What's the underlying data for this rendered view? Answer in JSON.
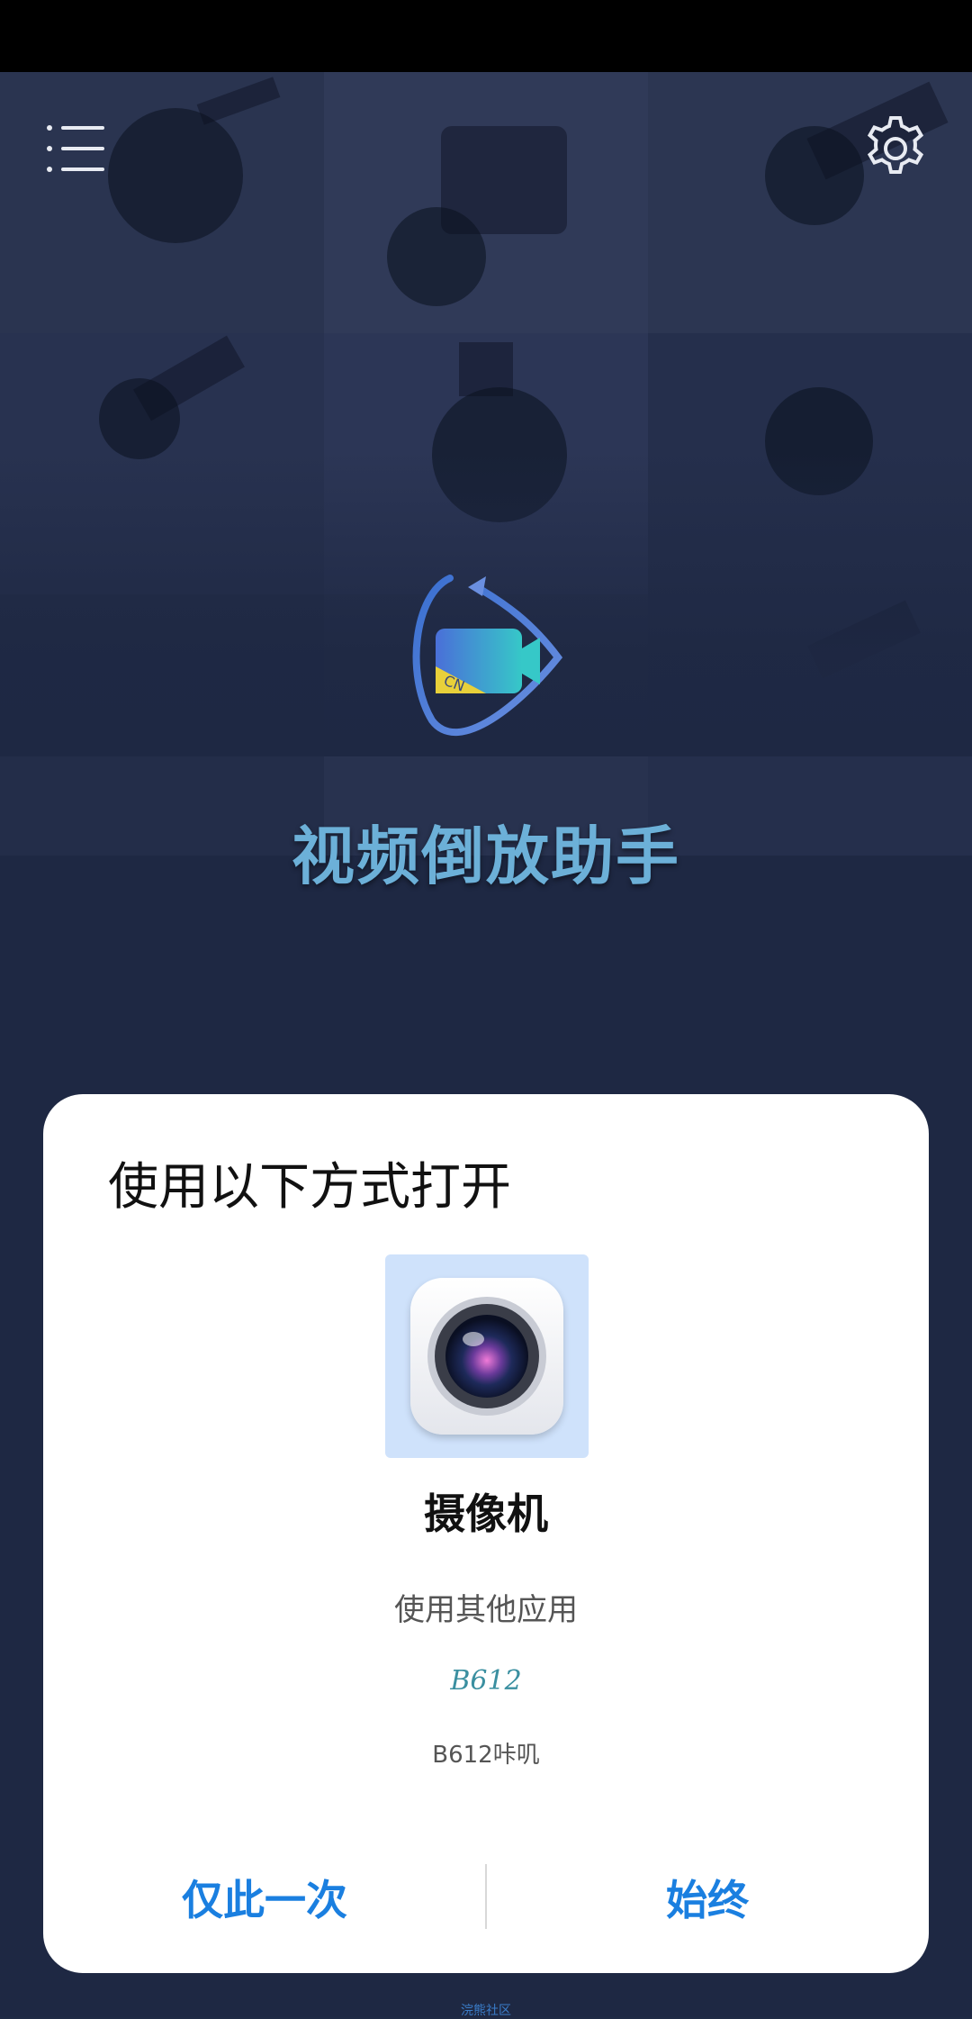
{
  "app": {
    "title": "视频倒放助手",
    "accent_color": "#6cb0d8"
  },
  "header": {
    "menu_icon": "menu-list-icon",
    "settings_icon": "gear-icon"
  },
  "dialog": {
    "title": "使用以下方式打开",
    "selected_app": {
      "label": "摄像机",
      "icon": "camera-lens-icon"
    },
    "other_apps_label": "使用其他应用",
    "other_apps": [
      {
        "label": "B612咔叽",
        "icon_text": "B612"
      }
    ],
    "buttons": {
      "once": "仅此一次",
      "always": "始终"
    },
    "button_color": "#1a7fe0"
  },
  "footer": {
    "watermark": "浣熊社区"
  }
}
